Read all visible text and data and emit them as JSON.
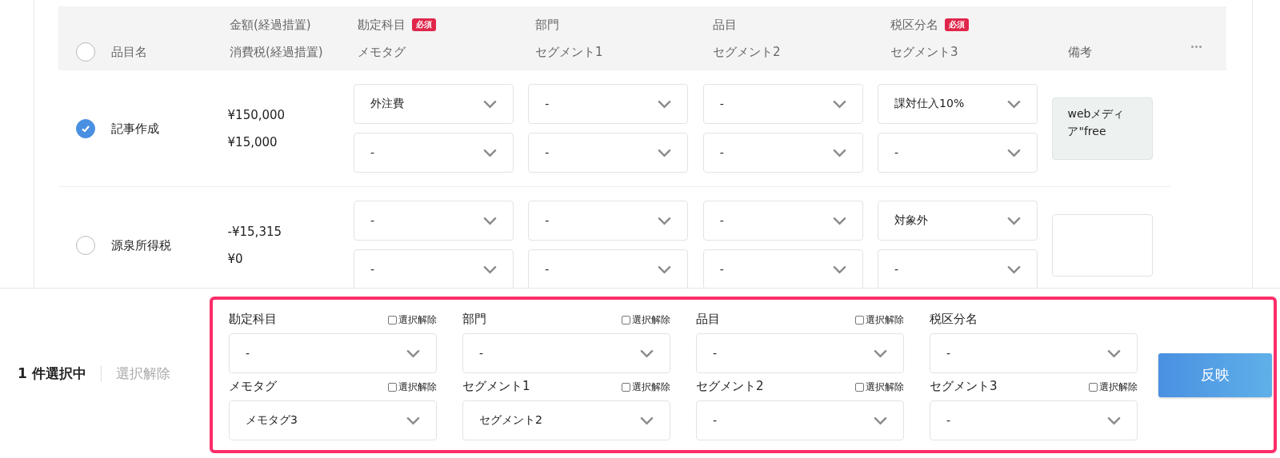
{
  "table": {
    "select_all": {
      "checked": false
    },
    "columns": [
      {
        "line_2": "品目名"
      },
      {
        "line_1": "金額(経過措置)",
        "line_2": "消費税(経過措置)"
      },
      {
        "line_1": "勘定科目",
        "badge": "必須",
        "line_2": "メモタグ"
      },
      {
        "line_1": "部門",
        "line_2": "セグメント1"
      },
      {
        "line_1": "品目",
        "line_2": "セグメント2"
      },
      {
        "line_1": "税区分名",
        "badge": "必須",
        "line_2": "セグメント3"
      },
      {
        "line_2": "備考"
      }
    ],
    "rows": [
      {
        "checked": true,
        "name": "記事作成",
        "amount": "¥150,000",
        "tax": "¥15,000",
        "selects": [
          [
            "外注費",
            "-"
          ],
          [
            "-",
            "-"
          ],
          [
            "-",
            "-"
          ],
          [
            "課対仕入10%",
            "-"
          ]
        ],
        "note": "webメディア\"free"
      },
      {
        "checked": false,
        "name": "源泉所得税",
        "amount": "-¥15,315",
        "tax": "¥0",
        "selects": [
          [
            "-",
            "-"
          ],
          [
            "-",
            "-"
          ],
          [
            "-",
            "-"
          ],
          [
            "対象外",
            "-"
          ]
        ]
      }
    ]
  },
  "selection_bar": {
    "count": "1 件選択中",
    "clear_link": "選択解除",
    "fields": [
      {
        "label": "勘定科目",
        "value": "-",
        "clear_checkbox": {
          "label": "選択解除",
          "checked": false
        }
      },
      {
        "label": "部門",
        "value": "-",
        "clear_checkbox": {
          "label": "選択解除",
          "checked": false
        }
      },
      {
        "label": "品目",
        "value": "-",
        "clear_checkbox": {
          "label": "選択解除",
          "checked": false
        }
      },
      {
        "label": "税区分名",
        "value": "-"
      },
      {
        "label": "メモタグ",
        "value": "メモタグ3",
        "clear_checkbox": {
          "label": "選択解除",
          "checked": false
        }
      },
      {
        "label": "セグメント1",
        "value": "セグメント2",
        "clear_checkbox": {
          "label": "選択解除",
          "checked": false
        }
      },
      {
        "label": "セグメント2",
        "value": "-",
        "clear_checkbox": {
          "label": "選択解除",
          "checked": false
        }
      },
      {
        "label": "セグメント3",
        "value": "-",
        "clear_checkbox": {
          "label": "選択解除",
          "checked": false
        }
      }
    ],
    "apply_button": "反映"
  }
}
